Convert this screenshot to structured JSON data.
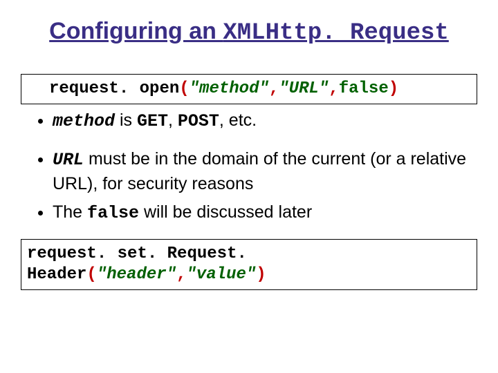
{
  "title": {
    "part1": "Configuring an ",
    "part2": "XMLHttp. Request"
  },
  "code1": {
    "obj": "request",
    "dot1": ".",
    "space1": " ",
    "method": "open",
    "lparen": "(",
    "arg1": "\"method\"",
    "comma1": ",",
    "arg2": "\"URL\"",
    "comma2": ",",
    "arg3": "false",
    "rparen": ")"
  },
  "bullets": {
    "b1_pre": "method",
    "b1_mid": " is ",
    "b1_get": "GET",
    "b1_sep": ", ",
    "b1_post": "POST",
    "b1_tail": ", etc.",
    "b2_pre": "URL",
    "b2_rest": " must be in the domain of the current (or a relative URL), for security reasons",
    "b3_pre": "The ",
    "b3_code": "false",
    "b3_rest": " will be discussed later"
  },
  "code2": {
    "obj": "request",
    "dot1": ".",
    "space1": " ",
    "method": "set. Request. Header",
    "lparen": "(",
    "arg1": "\"header\"",
    "comma1": ",",
    "arg2": "\"value\"",
    "rparen": ")"
  }
}
